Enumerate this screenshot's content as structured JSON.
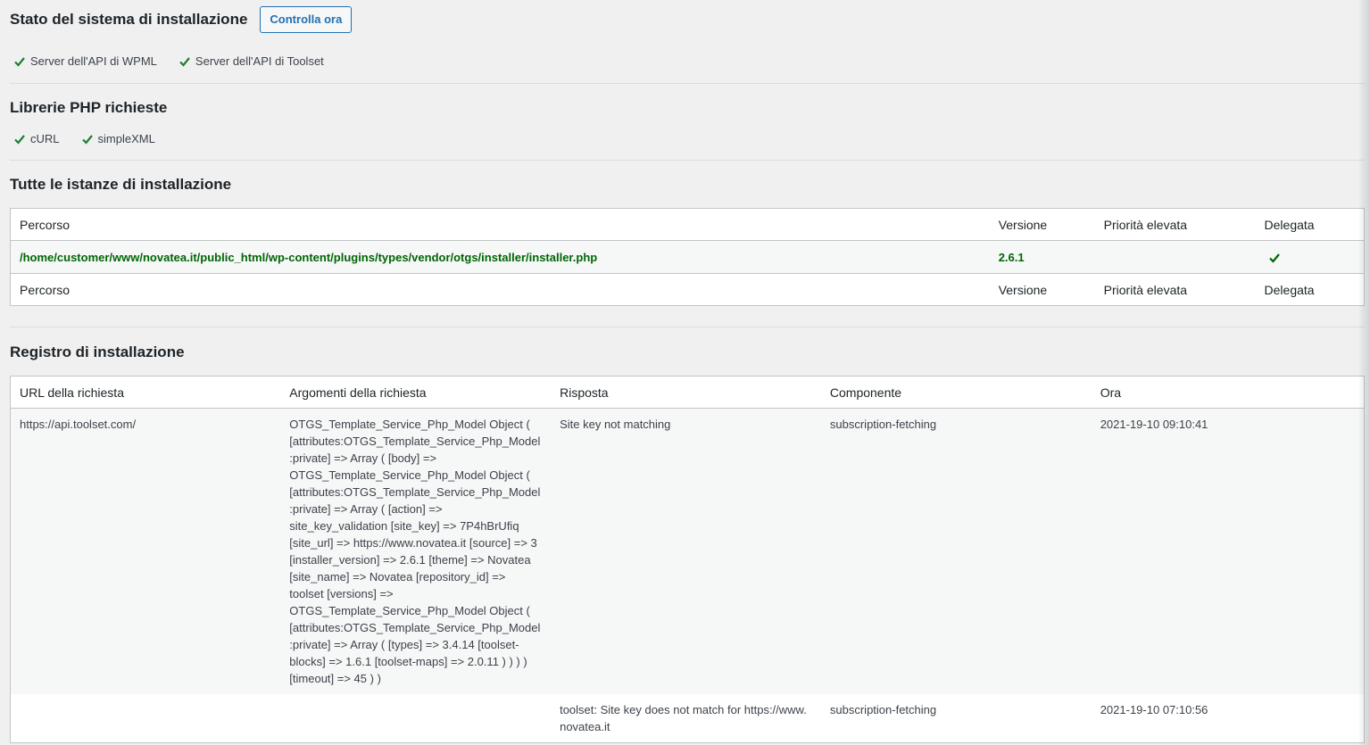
{
  "header": {
    "title": "Stato del sistema di installazione",
    "check_now_label": "Controlla ora",
    "servers": [
      "Server dell'API di WPML",
      "Server dell'API di Toolset"
    ]
  },
  "php_libraries": {
    "title": "Librerie PHP richieste",
    "items": [
      "cURL",
      "simpleXML"
    ]
  },
  "instances": {
    "title": "Tutte le istanze di installazione",
    "columns": [
      "Percorso",
      "Versione",
      "Priorità elevata",
      "Delegata"
    ],
    "rows": [
      {
        "path": "/home/customer/www/novatea.it/public_html/wp-content/plugins/types/vendor/otgs/installer/installer.php",
        "version": "2.6.1",
        "high_priority": "",
        "delegated": true
      }
    ]
  },
  "log": {
    "title": "Registro di installazione",
    "columns": [
      "URL della richiesta",
      "Argomenti della richiesta",
      "Risposta",
      "Componente",
      "Ora"
    ],
    "rows": [
      {
        "url": "https://api.toolset.com/",
        "args": "OTGS_Template_Service_Php_Model Object ( [attributes:OTGS_Template_Service_Php_Model:private] => Array ( [body] => OTGS_Template_Service_Php_Model Object ( [attributes:OTGS_Template_Service_Php_Model:private] => Array ( [action] => site_key_validation [site_key] => 7P4hBrUfiq [site_url] => https://www.novatea.it [source] => 3 [installer_version] => 2.6.1 [theme] => Novatea [site_name] => Novatea [repository_id] => toolset [versions] => OTGS_Template_Service_Php_Model Object ( [attributes:OTGS_Template_Service_Php_Model:private] => Array ( [types] => 3.4.14 [toolset-blocks] => 1.6.1 [toolset-maps] => 2.0.11 ) ) ) ) [timeout] => 45 ) )",
        "response": "Site key not matching",
        "component": "subscription-fetching",
        "time": "2021-19-10 09:10:41"
      },
      {
        "url": "",
        "args": "",
        "response": "toolset: Site key does not match for https://www.novatea.it",
        "component": "subscription-fetching",
        "time": "2021-19-10 07:10:56"
      }
    ]
  },
  "colors": {
    "accent": "#2271b1",
    "success": "#006505",
    "check": "#1e7e34"
  }
}
